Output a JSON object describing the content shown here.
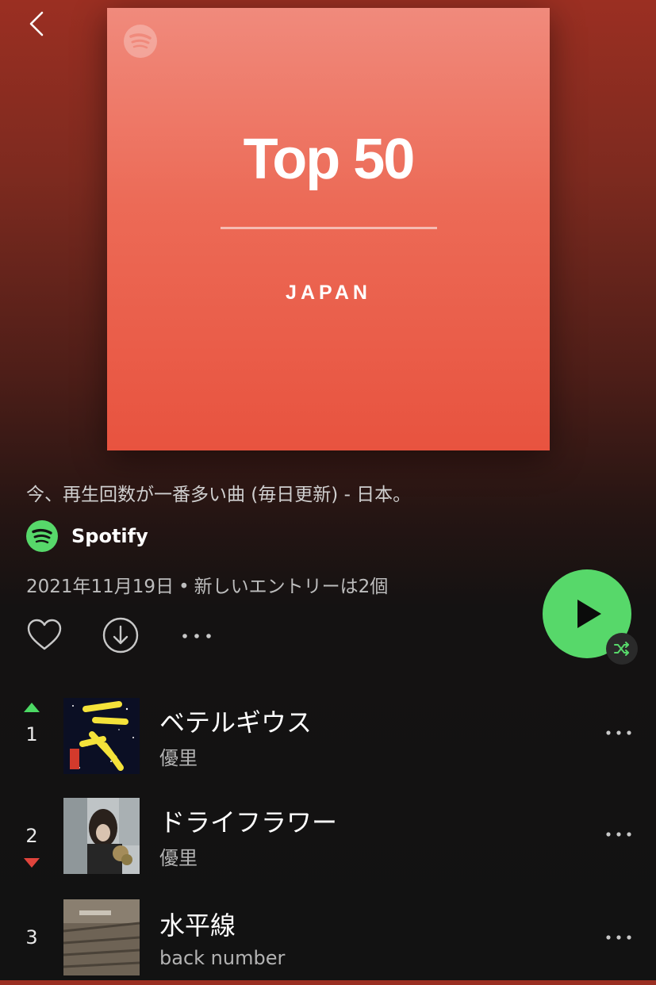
{
  "nav": {
    "back_icon": "chevron-left-icon"
  },
  "cover": {
    "title": "Top 50",
    "subtitle": "JAPAN",
    "logo_icon": "spotify-logo-icon",
    "colors": {
      "top": "#f08a7c",
      "bottom": "#e8533f"
    }
  },
  "playlist": {
    "description": "今、再生回数が一番多い曲 (毎日更新) - 日本。",
    "owner": "Spotify",
    "owner_icon": "spotify-logo-icon",
    "date": "2021年11月19日",
    "separator": "•",
    "new_entries": "新しいエントリーは2個"
  },
  "actions": {
    "like_icon": "heart-icon",
    "download_icon": "download-icon",
    "more_icon": "more-horizontal-icon",
    "play_icon": "play-icon",
    "shuffle_icon": "shuffle-icon",
    "accent_color": "#57d86a"
  },
  "tracks": [
    {
      "rank": "1",
      "trend": "up",
      "title": "ベテルギウス",
      "artist": "優里"
    },
    {
      "rank": "2",
      "trend": "down",
      "title": "ドライフラワー",
      "artist": "優里"
    },
    {
      "rank": "3",
      "trend": "none",
      "title": "水平線",
      "artist": "back number"
    }
  ]
}
